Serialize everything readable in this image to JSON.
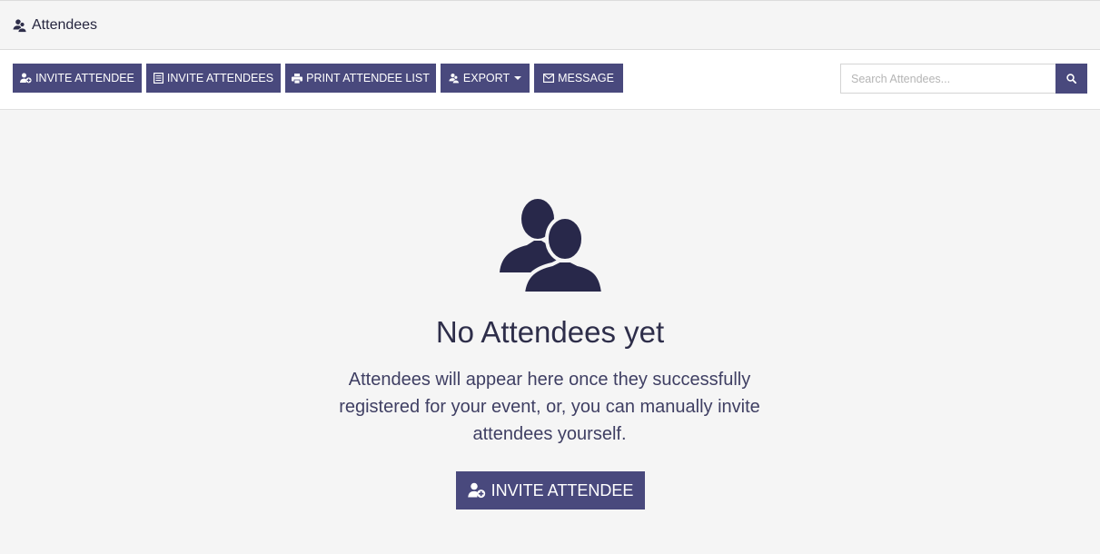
{
  "header": {
    "title": "Attendees",
    "icon": "users-icon"
  },
  "toolbar": {
    "buttons": [
      {
        "label": "INVITE ATTENDEE",
        "icon": "user-plus-icon"
      },
      {
        "label": "INVITE ATTENDEES",
        "icon": "list-icon"
      },
      {
        "label": "PRINT ATTENDEE LIST",
        "icon": "print-icon"
      },
      {
        "label": "EXPORT",
        "icon": "users-icon",
        "dropdown": true
      },
      {
        "label": "MESSAGE",
        "icon": "envelope-icon"
      }
    ],
    "search": {
      "value": "",
      "placeholder": "Search Attendees...",
      "icon": "search-icon"
    }
  },
  "empty_state": {
    "icon": "users-icon",
    "title": "No Attendees yet",
    "message": "Attendees will appear here once they successfully registered for your event, or, you can manually invite attendees yourself.",
    "cta_label": "INVITE ATTENDEE",
    "cta_icon": "user-plus-icon"
  },
  "colors": {
    "primary": "#49497d",
    "background": "#f5f5f5",
    "text": "#2e2e4a",
    "icon": "#28284a"
  }
}
